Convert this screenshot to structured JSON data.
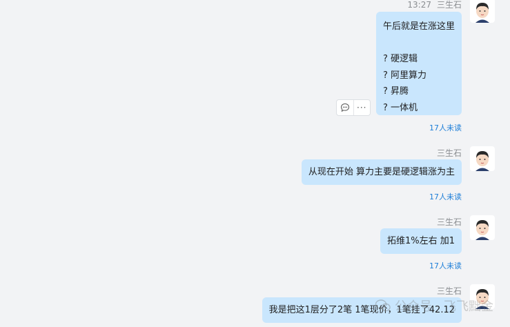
{
  "messages": [
    {
      "time": "13:27",
      "sender": "三生石",
      "text": "午后就是在涨这里\n\n? 硬逻辑\n? 阿里算力\n? 昇腾\n? 一体机",
      "read_status": "17人未读"
    },
    {
      "sender": "三生石",
      "text": "从现在开始 算力主要是硬逻辑涨为主",
      "read_status": "17人未读"
    },
    {
      "sender": "三生石",
      "text": "拓维1%左右 加1",
      "read_status": "17人未读"
    },
    {
      "sender": "三生石",
      "text": "我是把这1层分了2笔 1笔现价，1笔挂了42.12"
    }
  ],
  "hover_tools": {
    "reply_icon": "comment-icon",
    "more_icon": "more-icon",
    "more_label": "···"
  },
  "watermark": {
    "text": "公众号 · 飞飞黜金",
    "icon": "wechat-icon"
  }
}
